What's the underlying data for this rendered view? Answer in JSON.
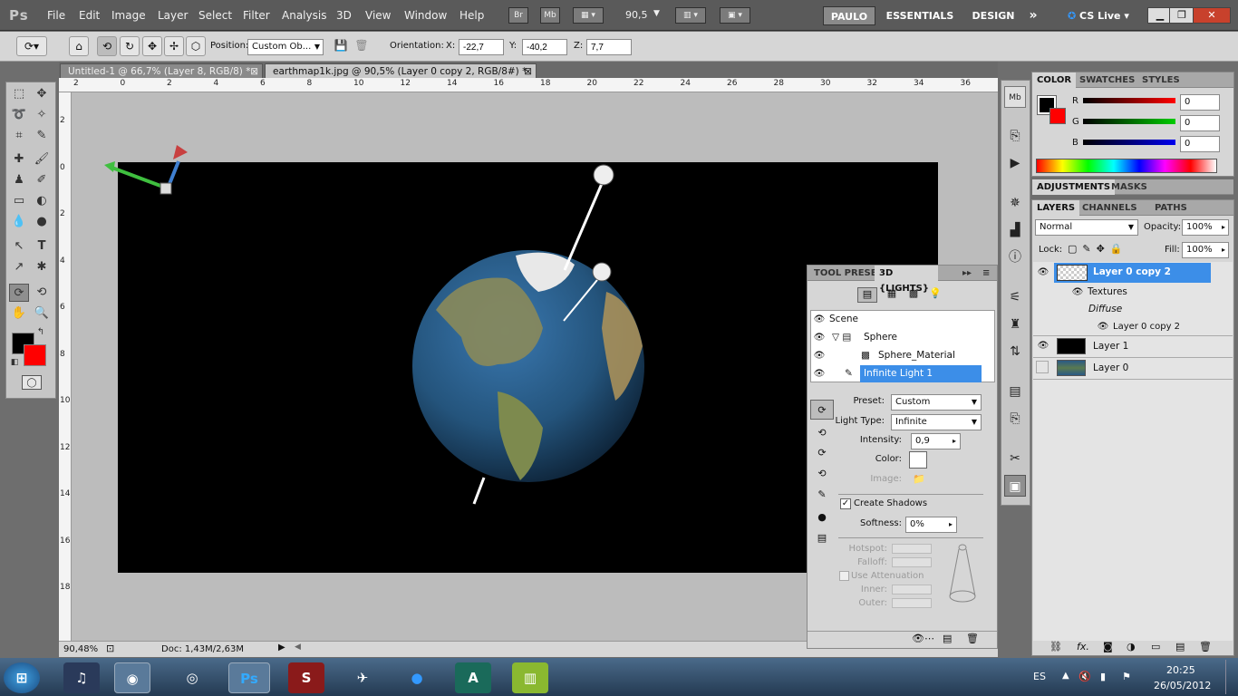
{
  "app": {
    "logo": "Ps"
  },
  "menu": [
    "File",
    "Edit",
    "Image",
    "Layer",
    "Select",
    "Filter",
    "Analysis",
    "3D",
    "View",
    "Window",
    "Help"
  ],
  "menu_buttons": {
    "bridge": "Br",
    "minibridge": "Mb",
    "zoom": "90,5"
  },
  "workspaces": {
    "user": "PAULO",
    "essentials": "ESSENTIALS",
    "design": "DESIGN",
    "more": "»",
    "cslive": "CS Live"
  },
  "options": {
    "position_label": "Position:",
    "position_value": "Custom Ob...",
    "orientation_label": "Orientation:",
    "x_label": "X:",
    "x_value": "-22,7",
    "y_label": "Y:",
    "y_value": "-40,2",
    "z_label": "Z:",
    "z_value": "7,7"
  },
  "documents": [
    {
      "title": "Untitled-1 @ 66,7% (Layer 8, RGB/8) *"
    },
    {
      "title": "earthmap1k.jpg @ 90,5% (Layer 0 copy 2, RGB/8#) *"
    }
  ],
  "ruler": {
    "h_ticks": [
      "2",
      "0",
      "2",
      "4",
      "6",
      "8",
      "10",
      "12",
      "14",
      "16",
      "18",
      "20",
      "22",
      "24",
      "26",
      "28",
      "30",
      "32",
      "34",
      "36"
    ],
    "v_ticks": [
      "2",
      "0",
      "2",
      "4",
      "6",
      "8",
      "10",
      "12",
      "14",
      "16",
      "18"
    ]
  },
  "status": {
    "zoom": "90,48%",
    "doc": "Doc: 1,43M/2,63M"
  },
  "color_panel": {
    "tabs": [
      "COLOR",
      "SWATCHES",
      "STYLES"
    ],
    "r_label": "R",
    "r_value": "0",
    "g_label": "G",
    "g_value": "0",
    "b_label": "B",
    "b_value": "0"
  },
  "adjust_panel": {
    "tabs": [
      "ADJUSTMENTS",
      "MASKS"
    ]
  },
  "layers_panel": {
    "tabs": [
      "LAYERS",
      "CHANNELS",
      "PATHS"
    ],
    "blend_mode": "Normal",
    "opacity_label": "Opacity:",
    "opacity_value": "100%",
    "lock_label": "Lock:",
    "fill_label": "Fill:",
    "fill_value": "100%",
    "layers": [
      {
        "name": "Layer 0 copy 2",
        "selected": true
      },
      {
        "name": "Textures"
      },
      {
        "name": "Diffuse"
      },
      {
        "name": "Layer 0 copy 2"
      },
      {
        "name": "Layer 1"
      },
      {
        "name": "Layer 0"
      }
    ]
  },
  "lights_panel": {
    "tabs": [
      "TOOL PRESET",
      "3D {LIGHTS}"
    ],
    "scene_items": [
      {
        "name": "Scene"
      },
      {
        "name": "Sphere"
      },
      {
        "name": "Sphere_Material"
      },
      {
        "name": "Infinite Light 1",
        "selected": true
      }
    ],
    "preset_label": "Preset:",
    "preset_value": "Custom",
    "light_type_label": "Light Type:",
    "light_type_value": "Infinite",
    "intensity_label": "Intensity:",
    "intensity_value": "0,9",
    "color_label": "Color:",
    "image_label": "Image:",
    "create_shadows_label": "Create Shadows",
    "softness_label": "Softness:",
    "softness_value": "0%",
    "hotspot_label": "Hotspot:",
    "falloff_label": "Falloff:",
    "use_attenuation_label": "Use Attenuation",
    "inner_label": "Inner:",
    "outer_label": "Outer:"
  },
  "taskbar": {
    "lang": "ES",
    "time": "20:25",
    "date": "26/05/2012",
    "ps": "Ps"
  },
  "colors": {
    "foreground": "#000000",
    "background": "#ff0000",
    "accent": "#3c8ee8"
  }
}
